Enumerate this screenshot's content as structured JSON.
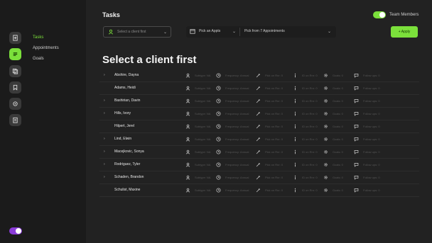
{
  "sidebar": {
    "rail": [
      {
        "icon": "document-add-icon",
        "active": false
      },
      {
        "icon": "task-list-icon",
        "active": true
      },
      {
        "icon": "copy-icon",
        "active": false
      },
      {
        "icon": "bookmark-icon",
        "active": false
      },
      {
        "icon": "settings-icon",
        "active": false
      },
      {
        "icon": "clipboard-icon",
        "active": false
      }
    ],
    "nav": [
      {
        "label": "Tasks",
        "active": true
      },
      {
        "label": "Appointments",
        "active": false
      },
      {
        "label": "Goals",
        "active": false
      }
    ],
    "theme_toggle_on": true
  },
  "header": {
    "title": "Tasks",
    "team_toggle_label": "Team Members",
    "team_toggle_on": true
  },
  "filters": {
    "client_placeholder": "Select a client first",
    "date_label": "Pick an Appts",
    "appointments_label": "Pick from 7 Appointments",
    "apply_label": "+ Apply"
  },
  "main": {
    "headline": "Select a client first"
  },
  "columns": [
    {
      "icon": "user-icon",
      "label": "Subtype: NA"
    },
    {
      "icon": "clock-icon",
      "label": "Frequency: Annual"
    },
    {
      "icon": "magic-icon",
      "label": "Pick on Rnr: 0"
    },
    {
      "icon": "info-icon",
      "label": "ID on Rnr: 0"
    },
    {
      "icon": "gear-icon",
      "label": "Goals: 0"
    },
    {
      "icon": "chat-icon",
      "label": "Follow ups: 0"
    }
  ],
  "clients": [
    {
      "name": "Abshire, Dayna",
      "expandable": true
    },
    {
      "name": "Adams, Heidi",
      "expandable": false
    },
    {
      "name": "Bashirian, Davin",
      "expandable": true
    },
    {
      "name": "Hills, Ivory",
      "expandable": true
    },
    {
      "name": "Hilpert, Jerel",
      "expandable": false
    },
    {
      "name": "Lind, Elwin",
      "expandable": true
    },
    {
      "name": "Macejkovic, Sonya",
      "expandable": true
    },
    {
      "name": "Rodriguez, Tyler",
      "expandable": true
    },
    {
      "name": "Schaden, Brandon",
      "expandable": true
    },
    {
      "name": "Schulist, Maxine",
      "expandable": false
    }
  ],
  "colors": {
    "accent": "#7be03b",
    "toggle_purple": "#8a3bd8",
    "bg": "#222222",
    "sidebar_bg": "#1b1b1b"
  }
}
